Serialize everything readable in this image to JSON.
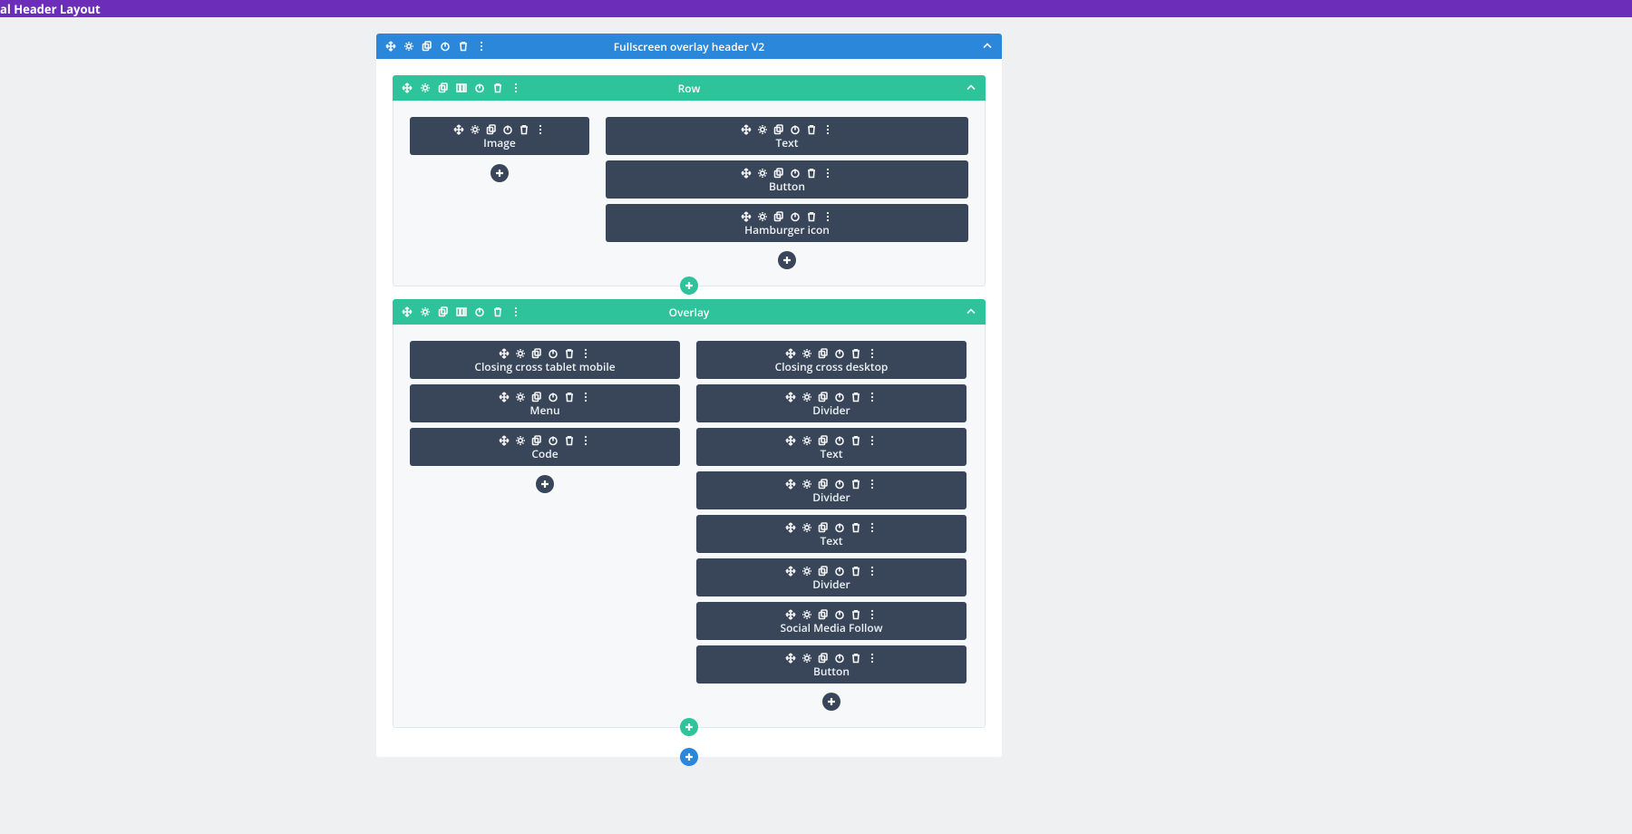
{
  "topbar": {
    "title": "al Header Layout"
  },
  "section": {
    "title": "Fullscreen overlay header V2",
    "rows": [
      {
        "title": "Row",
        "columns": [
          {
            "width": "33",
            "modules": [
              {
                "label": "Image"
              }
            ]
          },
          {
            "width": "66",
            "modules": [
              {
                "label": "Text"
              },
              {
                "label": "Button"
              },
              {
                "label": "Hamburger icon"
              }
            ]
          }
        ]
      },
      {
        "title": "Overlay",
        "columns": [
          {
            "width": "50",
            "modules": [
              {
                "label": "Closing cross tablet mobile"
              },
              {
                "label": "Menu"
              },
              {
                "label": "Code"
              }
            ]
          },
          {
            "width": "50",
            "modules": [
              {
                "label": "Closing cross desktop"
              },
              {
                "label": "Divider"
              },
              {
                "label": "Text"
              },
              {
                "label": "Divider"
              },
              {
                "label": "Text"
              },
              {
                "label": "Divider"
              },
              {
                "label": "Social Media Follow"
              },
              {
                "label": "Button"
              }
            ]
          }
        ]
      }
    ]
  }
}
